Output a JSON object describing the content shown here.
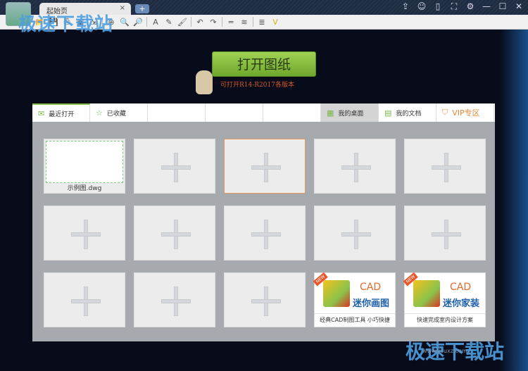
{
  "titlebar": {
    "tab_label": "起始页",
    "tab_close": "×",
    "new_tab": "+",
    "controls": [
      "share-icon",
      "wechat-icon",
      "mobile-icon",
      "fullscreen-icon",
      "settings-icon",
      "minimize-icon",
      "maximize-icon",
      "close-icon"
    ],
    "control_glyphs": [
      "⇪",
      "☺",
      "▯",
      "⛶",
      "⚙",
      "—",
      "☐",
      "✕"
    ]
  },
  "toolbar": {
    "tools": [
      "open",
      "save",
      "print",
      "pdf",
      "export",
      "zoom-in",
      "zoom-window",
      "zoom-extents",
      "text",
      "pencil",
      "brush",
      "undo",
      "redo",
      "measure",
      "layer-line",
      "layers",
      "vip"
    ],
    "glyphs": [
      "📂",
      "💾",
      "⎙",
      "▣",
      "⇲",
      "⊕",
      "🔍",
      "🔎",
      "A",
      "✎",
      "🖌",
      "↶",
      "↷",
      "═",
      "≋",
      "≣",
      "V"
    ]
  },
  "watermark": "极速下载站",
  "watermark_url": "www.jisuxz.com",
  "main": {
    "open_button": "打开图纸",
    "subtitle": "可打开R14-R2017各版本"
  },
  "tabs": [
    {
      "label": "最近打开",
      "icon": "✉"
    },
    {
      "label": "已收藏",
      "icon": "☆"
    },
    {
      "label": ""
    },
    {
      "label": ""
    },
    {
      "label": ""
    },
    {
      "label": "我的桌面",
      "icon": "▦"
    },
    {
      "label": "我的文档",
      "icon": "▤"
    },
    {
      "label": "VIP专区",
      "icon": "⛉"
    }
  ],
  "recent": {
    "file_name": "示例图.dwg"
  },
  "ads": [
    {
      "badge": "NEW",
      "brand": "CAD",
      "name": "迷你画图",
      "desc": "经典CAD制图工具 小巧快捷"
    },
    {
      "badge": "NEW",
      "brand": "CAD",
      "name": "迷你家装",
      "desc": "快速完成室内设计方案"
    }
  ]
}
